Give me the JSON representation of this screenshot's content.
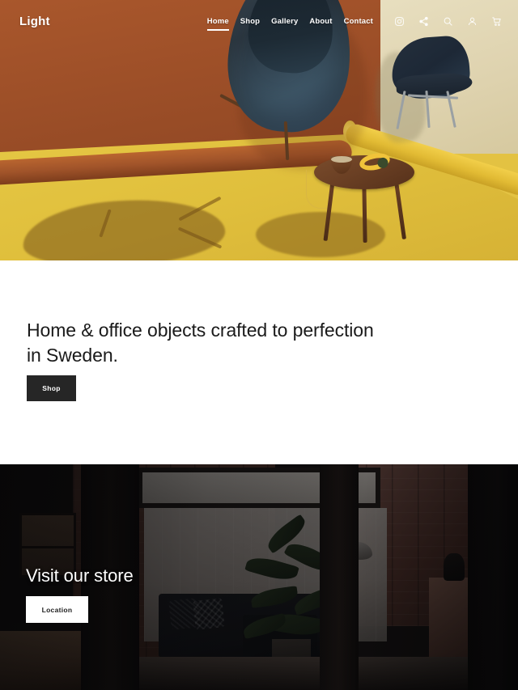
{
  "site": {
    "brand": "Light"
  },
  "nav": {
    "links": [
      {
        "label": "Home",
        "active": true
      },
      {
        "label": "Shop",
        "active": false
      },
      {
        "label": "Gallery",
        "active": false
      },
      {
        "label": "About",
        "active": false
      },
      {
        "label": "Contact",
        "active": false
      }
    ],
    "icons": [
      {
        "name": "instagram-icon"
      },
      {
        "name": "share-icon"
      },
      {
        "name": "search-icon"
      },
      {
        "name": "user-account-icon"
      },
      {
        "name": "shopping-cart-icon"
      }
    ]
  },
  "hero": {
    "alt": "Brown paper backdrop with yellow floor, teal pod chair, navy side chair and wooden side table"
  },
  "intro": {
    "headline": "Home & office objects crafted to perfection in Sweden.",
    "cta_label": "Shop"
  },
  "store": {
    "title": "Visit our store",
    "cta_label": "Location",
    "alt": "Dark loft interior with brick walls, sofa, plants and windows"
  },
  "colors": {
    "hero_backdrop_brown": "#a1542a",
    "hero_floor_yellow": "#e3c242",
    "hero_wall_cream": "#ded2ae",
    "chair_navy": "#242f3c",
    "button_dark": "#262626",
    "button_light": "#ffffff",
    "text_dark": "#1a1a1a",
    "text_light": "#ffffff"
  }
}
